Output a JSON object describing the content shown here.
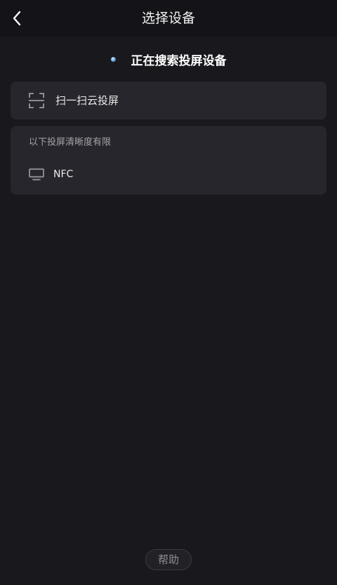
{
  "header": {
    "title": "选择设备",
    "back_icon": "chevron-left-icon"
  },
  "status": {
    "searching_text": "正在搜索投屏设备",
    "spinner_color": "#5da0d8"
  },
  "scan_option": {
    "label": "扫一扫云投屏",
    "icon": "scan-frame-icon"
  },
  "device_list": {
    "note": "以下投屏清晰度有限",
    "devices": [
      {
        "label": "NFC",
        "icon": "tv-icon"
      }
    ]
  },
  "footer": {
    "help_label": "帮助"
  },
  "colors": {
    "background": "#18181d",
    "card": "#26262c",
    "text_primary": "#ffffff",
    "text_secondary": "#a3a3a8"
  }
}
